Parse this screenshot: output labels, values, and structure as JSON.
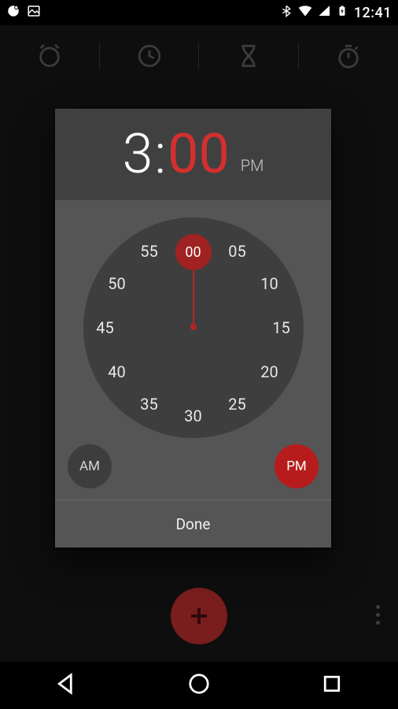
{
  "status": {
    "time": "12:41"
  },
  "tabs": [
    "alarm",
    "clock",
    "timer",
    "stopwatch"
  ],
  "picker": {
    "hour": "3",
    "minute": "00",
    "ampm_label": "PM",
    "am_label": "AM",
    "pm_label": "PM",
    "selected_tick": "00",
    "ticks": [
      "00",
      "05",
      "10",
      "15",
      "20",
      "25",
      "30",
      "35",
      "40",
      "45",
      "50",
      "55"
    ],
    "done_label": "Done"
  }
}
